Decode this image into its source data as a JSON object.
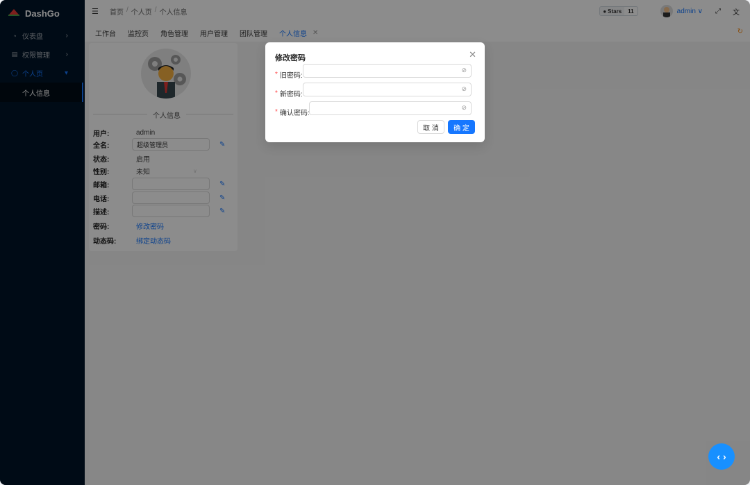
{
  "app": {
    "title": "DashGo"
  },
  "sidebar": {
    "items": [
      {
        "label": "仪表盘",
        "icon": "dashboard-icon"
      },
      {
        "label": "权限管理",
        "icon": "permission-icon"
      },
      {
        "label": "个人页",
        "icon": "user-icon"
      }
    ],
    "submenu": [
      {
        "label": "个人信息"
      }
    ]
  },
  "header": {
    "breadcrumb": [
      "首页",
      "个人页",
      "个人信息"
    ],
    "github": {
      "label": "Stars",
      "count": "11"
    },
    "user": "admin"
  },
  "tabs": [
    {
      "label": "工作台"
    },
    {
      "label": "监控页"
    },
    {
      "label": "角色管理"
    },
    {
      "label": "用户管理"
    },
    {
      "label": "团队管理"
    },
    {
      "label": "个人信息"
    }
  ],
  "profile": {
    "section_title": "个人信息",
    "user_label": "用户:",
    "user_value": "admin",
    "fullname_label": "全名:",
    "fullname_value": "超级管理员",
    "status_label": "状态:",
    "status_value": "启用",
    "gender_label": "性别:",
    "gender_value": "未知",
    "email_label": "邮箱:",
    "email_value": "",
    "phone_label": "电话:",
    "phone_value": "",
    "desc_label": "描述:",
    "desc_value": "",
    "password_label": "密码:",
    "password_link": "修改密码",
    "otp_label": "动态码:",
    "otp_link": "绑定动态码"
  },
  "modal": {
    "title": "修改密码",
    "old_label": "旧密码:",
    "new_label": "新密码:",
    "confirm_label": "确认密码:",
    "cancel": "取 消",
    "ok": "确 定"
  }
}
